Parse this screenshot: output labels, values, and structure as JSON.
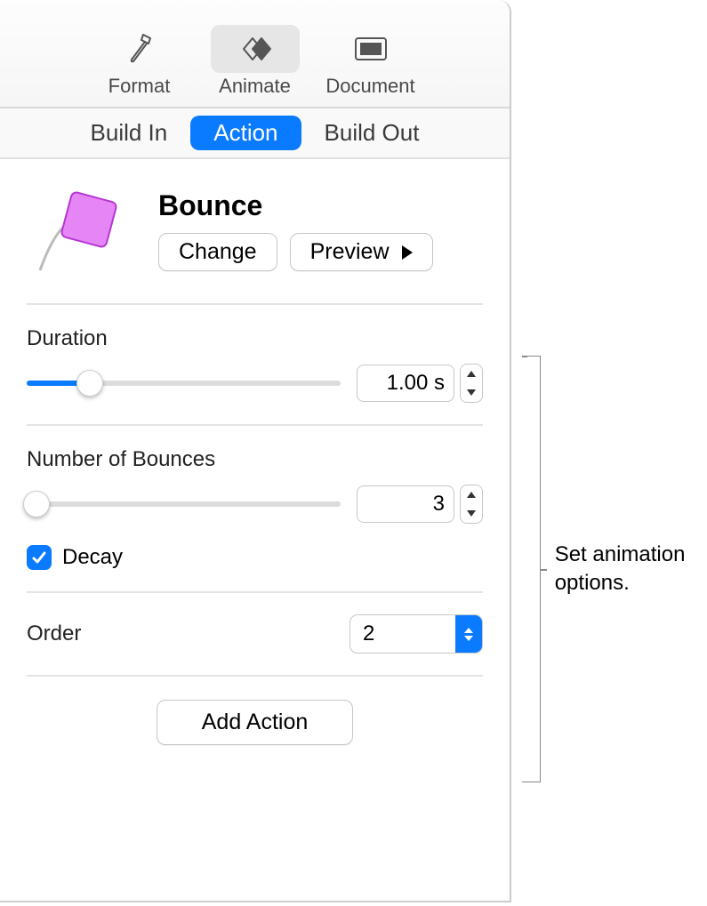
{
  "toolbar": {
    "format": "Format",
    "animate": "Animate",
    "document": "Document"
  },
  "tabs": {
    "build_in": "Build In",
    "action": "Action",
    "build_out": "Build Out"
  },
  "effect": {
    "name": "Bounce",
    "change_label": "Change",
    "preview_label": "Preview"
  },
  "duration": {
    "label": "Duration",
    "value": "1.00 s",
    "slider_percent": 20
  },
  "bounces": {
    "label": "Number of Bounces",
    "value": "3",
    "slider_percent": 3
  },
  "decay": {
    "label": "Decay",
    "checked": true
  },
  "order": {
    "label": "Order",
    "value": "2"
  },
  "add_action_label": "Add Action",
  "callout": "Set animation options."
}
